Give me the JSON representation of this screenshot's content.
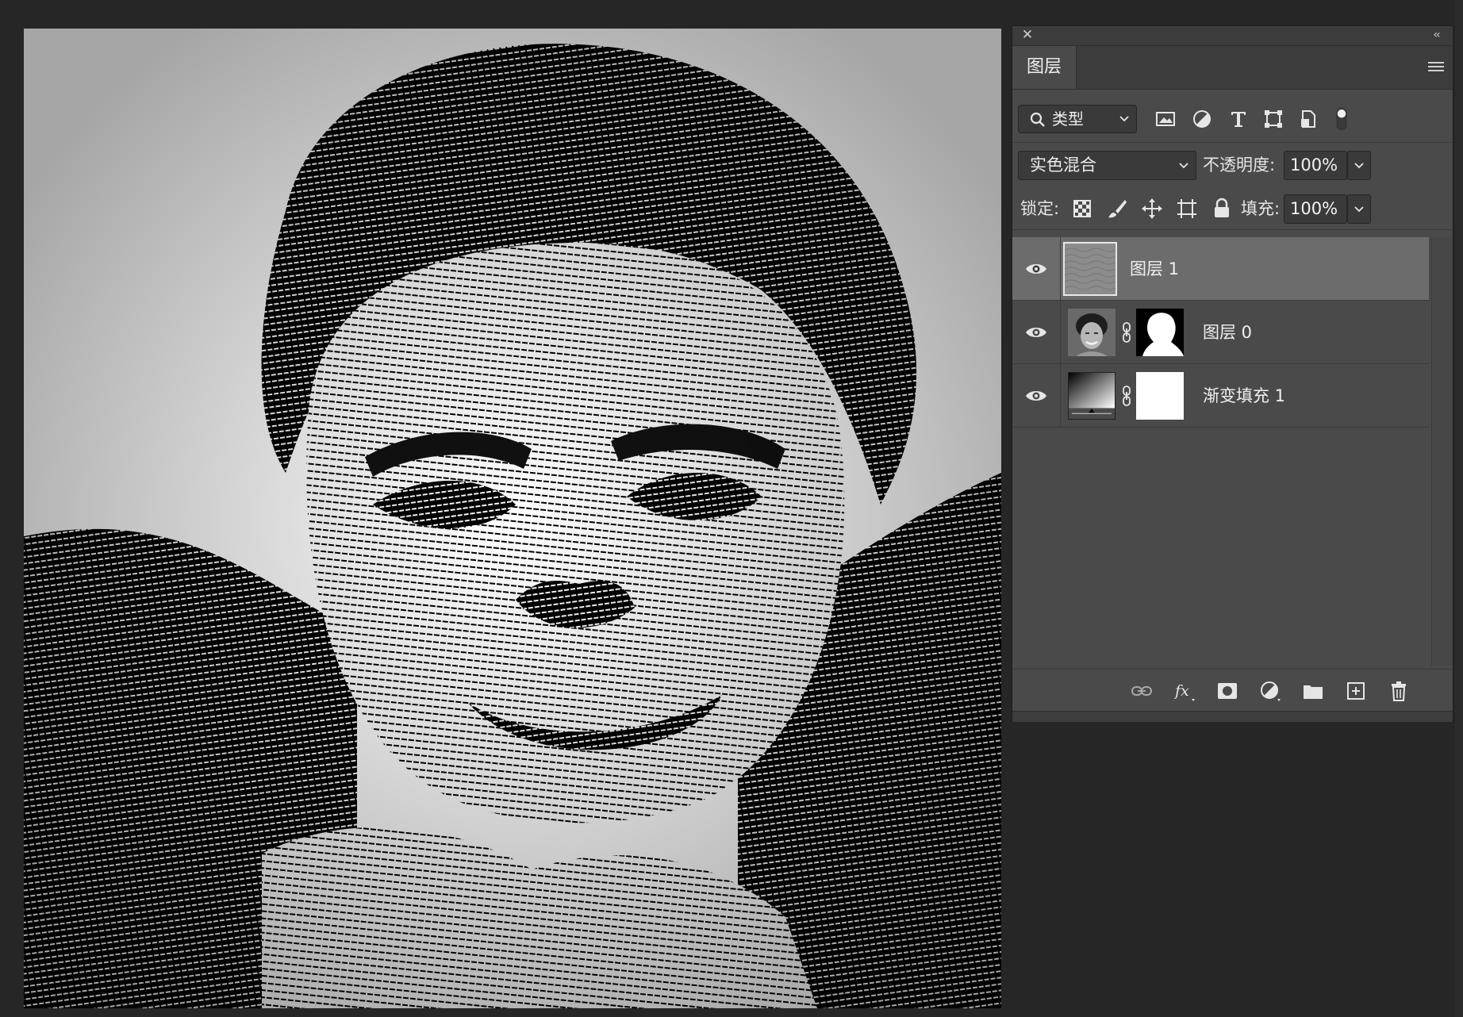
{
  "canvas": {
    "description_icon": "halftone-portrait-image"
  },
  "panel": {
    "tab_label": "图层",
    "filter": {
      "kind_label": "类型",
      "icons": [
        "image-filter-icon",
        "adjustment-filter-icon",
        "type-filter-icon",
        "shape-filter-icon",
        "smart-object-filter-icon",
        "filter-toggle-icon"
      ]
    },
    "blend_mode": "实色混合",
    "opacity_label": "不透明度:",
    "opacity_value": "100%",
    "lock_label": "锁定:",
    "fill_label": "填充:",
    "fill_value": "100%",
    "layers": [
      {
        "name": "图层 1",
        "selected": true,
        "visible": true
      },
      {
        "name": "图层 0",
        "selected": false,
        "visible": true
      },
      {
        "name": "渐变填充 1",
        "selected": false,
        "visible": true
      }
    ],
    "footer_icons": [
      "link-layers-icon",
      "fx-icon",
      "add-mask-icon",
      "adjustment-layer-icon",
      "new-group-icon",
      "new-layer-icon",
      "delete-icon"
    ],
    "colors": {
      "panel_bg": "#4a4a4a",
      "selected_row": "#6c6c6c",
      "app_bg": "#262626"
    }
  }
}
